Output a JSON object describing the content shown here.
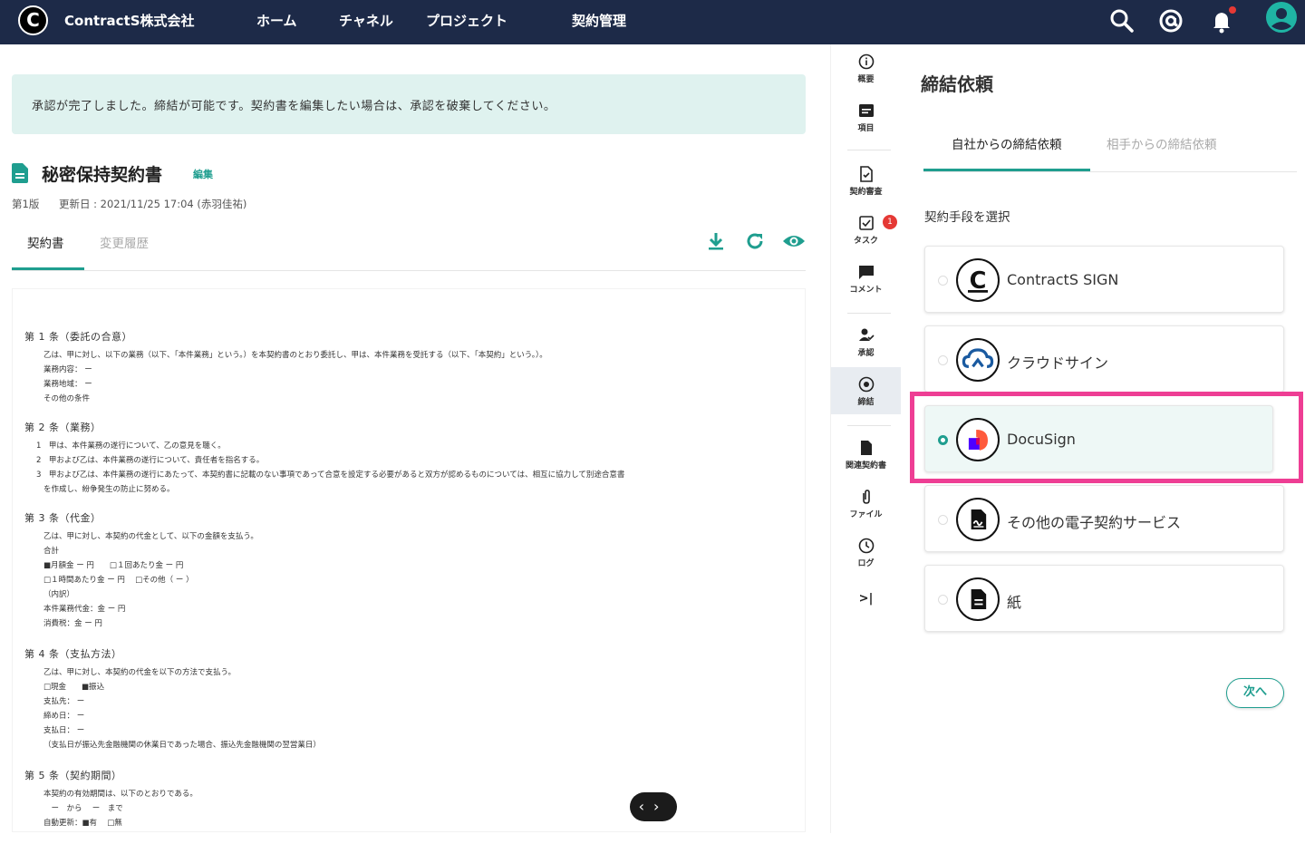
{
  "topbar": {
    "logo_letter": "C",
    "company": "ContractS株式会社",
    "nav": [
      "ホーム",
      "チャネル",
      "プロジェクト",
      "契約管理"
    ]
  },
  "banner": {
    "text": "承認が完了しました。締結が可能です。契約書を編集したい場合は、承認を破棄してください。"
  },
  "document": {
    "title": "秘密保持契約書",
    "edit_label": "編集",
    "version": "第1版",
    "updated": "更新日 : 2021/11/25 17:04 (赤羽佳祐)",
    "tabs": [
      "契約書",
      "変更履歴"
    ],
    "articles": [
      {
        "heading": "第 1 条（委託の合意）",
        "lines": [
          "乙は、甲に対し、以下の業務（以下、「本件業務」という。）を本契約書のとおり委託し、甲は、本件業務を受託する（以下、「本契約」という。）。",
          "業務内容： ー",
          "業務地域： ー",
          "その他の条件"
        ]
      },
      {
        "heading": "第 2 条（業務）",
        "lines": [
          "1　甲は、本件業務の遂行について、乙の意見を聴く。",
          "2　甲および乙は、本件業務の遂行について、責任者を指名する。",
          "3　甲および乙は、本件業務の遂行にあたって、本契約書に記載のない事項であって合意を設定する必要があると双方が認めるものについては、相互に協力して別途合意書",
          "を作成し、紛争発生の防止に努める。"
        ]
      },
      {
        "heading": "第 3 条（代金）",
        "lines": [
          "乙は、甲に対し、本契約の代金として、以下の金額を支払う。",
          "合計",
          "■月額金 ー 円　　□１回あたり金 ー 円",
          "□１時間あたり金 ー 円　 □その他（ ー ）",
          "（内訳）",
          "本件業務代金：金 ー 円",
          "消費税：金 ー 円"
        ]
      },
      {
        "heading": "第 4 条（支払方法）",
        "lines": [
          "乙は、甲に対し、本契約の代金を以下の方法で支払う。",
          "□現金　　■振込",
          "支払先： ー",
          "締め日： ー",
          "支払日： ー",
          "（支払日が振込先金融機関の休業日であった場合、振込先金融機関の翌営業日）"
        ]
      },
      {
        "heading": "第 5 条（契約期間）",
        "lines": [
          "本契約の有効期間は、以下のとおりである。",
          "　ー　から　 ー　まで",
          "自動更新：■有　 □無"
        ]
      }
    ]
  },
  "pager": {
    "prev": "‹",
    "next": "›"
  },
  "rail": {
    "items": [
      {
        "label": "概要",
        "icon": "info-icon"
      },
      {
        "label": "項目",
        "icon": "fields-icon"
      },
      {
        "label": "契約審査",
        "icon": "review-icon"
      },
      {
        "label": "タスク",
        "icon": "task-icon",
        "badge": "1"
      },
      {
        "label": "コメント",
        "icon": "comment-icon"
      },
      {
        "label": "承認",
        "icon": "approval-icon"
      },
      {
        "label": "締結",
        "icon": "execution-icon"
      },
      {
        "label": "関連契約書",
        "icon": "related-doc-icon"
      },
      {
        "label": "ファイル",
        "icon": "paperclip-icon"
      },
      {
        "label": "ログ",
        "icon": "clock-icon"
      }
    ],
    "collapse": ">|"
  },
  "panel": {
    "title": "締結依頼",
    "tabs": [
      "自社からの締結依頼",
      "相手からの締結依頼"
    ],
    "section_label": "契約手段を選択",
    "options": [
      {
        "label": "ContractS SIGN",
        "icon": "contracts-sign-logo"
      },
      {
        "label": "クラウドサイン",
        "icon": "cloudsign-logo"
      },
      {
        "label": "DocuSign",
        "icon": "docusign-logo",
        "selected": true
      },
      {
        "label": "その他の電子契約サービス",
        "icon": "other-esign-icon"
      },
      {
        "label": "紙",
        "icon": "paper-icon"
      }
    ],
    "next_label": "次へ"
  },
  "colors": {
    "topbar": "#1d2a48",
    "accent": "#1f9e8f",
    "highlight": "#ee3e94",
    "badge": "#e53935"
  }
}
